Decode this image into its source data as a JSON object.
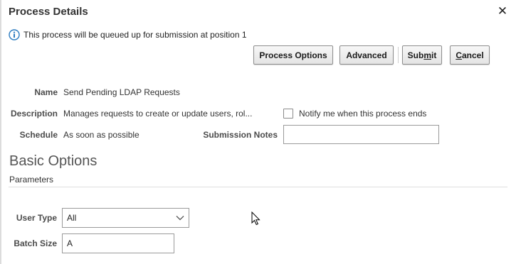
{
  "dialog": {
    "title": "Process Details",
    "close_glyph": "✕",
    "info_message": "This process will be queued up for submission at position 1"
  },
  "toolbar": {
    "process_options_label": "Process Options",
    "advanced_label": "Advanced",
    "submit_pre": "Sub",
    "submit_mnemonic": "m",
    "submit_post": "it",
    "cancel_mnemonic": "C",
    "cancel_post": "ancel"
  },
  "details": {
    "name_label": "Name",
    "name_value": "Send Pending LDAP Requests",
    "description_label": "Description",
    "description_value": "Manages requests to create or update users, rol...",
    "schedule_label": "Schedule",
    "schedule_value": "As soon as possible",
    "notify_label": "Notify me when this process ends",
    "notify_checked": false,
    "submission_notes_label": "Submission Notes",
    "submission_notes_value": ""
  },
  "basic_options": {
    "title": "Basic Options",
    "parameters_label": "Parameters",
    "user_type_label": "User Type",
    "user_type_value": "All",
    "batch_size_label": "Batch Size",
    "batch_size_value": "A"
  },
  "icons": {
    "info": "info-icon",
    "close": "close-icon",
    "dropdown": "chevron-down-icon",
    "cursor": "mouse-pointer-icon"
  },
  "colors": {
    "info_blue": "#2b7bc0",
    "button_border": "#8e8e8e",
    "section_title": "#555555"
  }
}
